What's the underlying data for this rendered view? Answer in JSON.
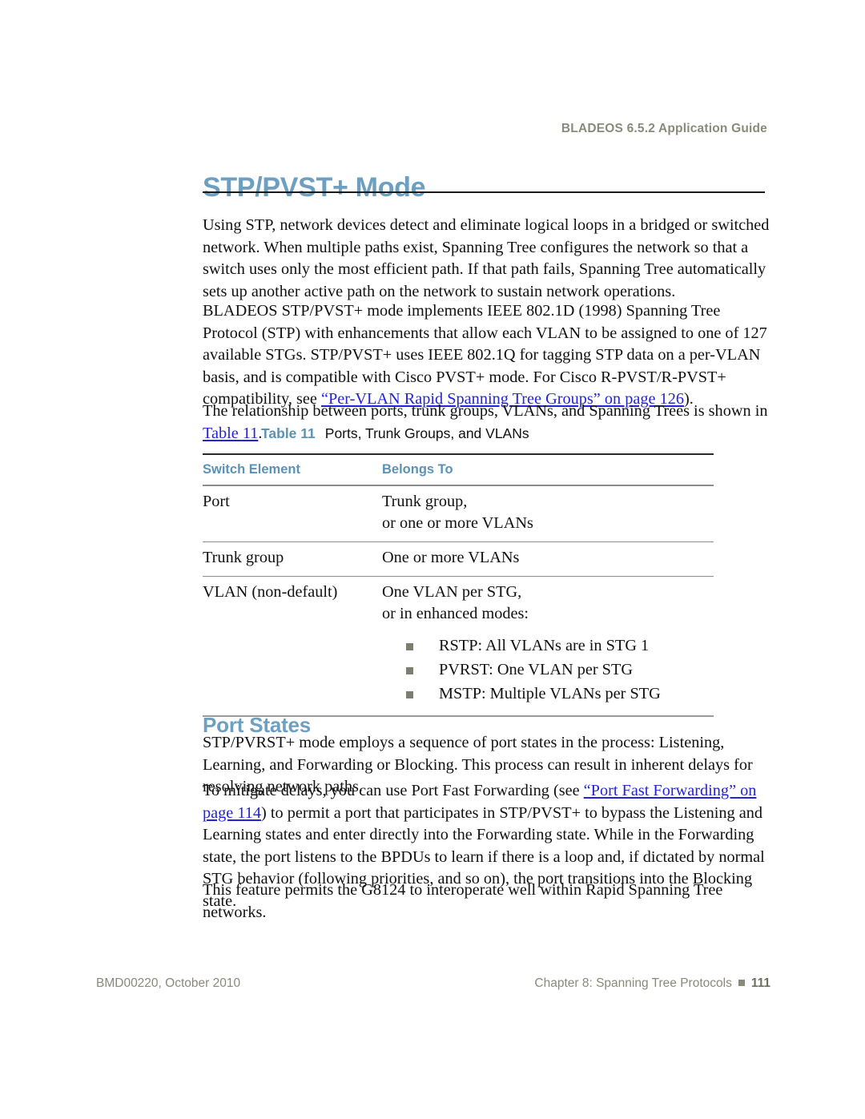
{
  "header": {
    "running_title": "BLADEOS 6.5.2 Application Guide"
  },
  "title": {
    "text": "STP/PVST+ Mode",
    "color": "#6d9fc0"
  },
  "paragraphs": {
    "intro": "Using STP, network devices detect and eliminate logical loops in a bridged or switched network. When multiple paths exist, Spanning Tree configures the network so that a switch uses only the most efficient path. If that path fails, Spanning Tree automatically sets up another active path on the network to sustain network operations.",
    "p2_before_link": "BLADEOS STP/PVST+ mode implements IEEE 802.1D (1998) Spanning Tree Protocol (STP) with enhancements that allow each VLAN to be assigned to one of 127 available STGs. STP/PVST+ uses IEEE 802.1Q for tagging STP data on a per-VLAN basis, and is compatible with Cisco PVST+ mode. For Cisco R-PVST/R-PVST+ compatibility, see ",
    "p2_link": "“Per-VLAN Rapid Spanning Tree Groups” on page 126",
    "p2_after_link": ").",
    "p3_before_link": "The relationship between ports, trunk groups, VLANs, and Spanning Trees is shown in ",
    "p3_link": "Table 11",
    "p3_after_link": ".",
    "port_states_p1": "STP/PVRST+ mode employs a sequence of port states in the process: Listening, Learning, and Forwarding or Blocking. This process can result in inherent delays for resolving network paths.",
    "port_states_p2_before_link": "To mitigate delays, you can use Port Fast Forwarding (see ",
    "port_states_p2_link": "“Port Fast Forwarding” on page 114",
    "port_states_p2_after_link": ") to permit a port that participates in STP/PVST+ to bypass the Listening and Learning states and enter directly into the Forwarding state. While in the Forwarding state, the port listens to the BPDUs to learn if there is a loop and, if dictated by normal STG behavior (following priorities, and so on), the port transitions into the Blocking state.",
    "closing": "This feature permits the G8124 to interoperate well within Rapid Spanning Tree networks."
  },
  "table": {
    "caption_number": "Table 11",
    "caption_text": "Ports, Trunk Groups, and VLANs",
    "columns": [
      "Switch Element",
      "Belongs To"
    ],
    "rows": [
      {
        "element": "Port",
        "belongs_to_lines": [
          "Trunk group,",
          "or one or more VLANs"
        ],
        "bullets": []
      },
      {
        "element": "Trunk group",
        "belongs_to_lines": [
          "One or more VLANs"
        ],
        "bullets": []
      },
      {
        "element": "VLAN (non-default)",
        "belongs_to_lines": [
          "One VLAN per STG,",
          "or in enhanced modes:"
        ],
        "bullets": [
          "RSTP: All VLANs are in STG 1",
          "PVRST: One VLAN per STG",
          "MSTP: Multiple VLANs per STG"
        ]
      }
    ]
  },
  "sections": {
    "port_states_heading": "Port States"
  },
  "footer": {
    "left": "BMD00220, October 2010",
    "chapter": "Chapter 8: Spanning Tree Protocols",
    "page_number": "111"
  }
}
